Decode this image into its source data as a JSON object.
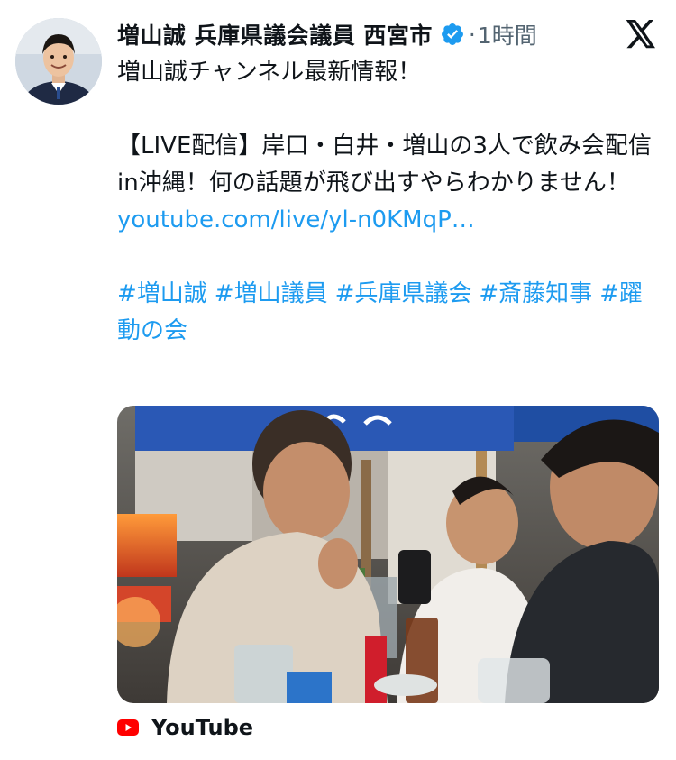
{
  "author": {
    "display_name": "増山誠 兵庫県議会議員 西宮市",
    "separator": "·",
    "timestamp": "1時間",
    "verified": true
  },
  "tweet": {
    "line1": "増山誠チャンネル最新情報！",
    "para2": "【LIVE配信】岸口・白井・増山の3人で飲み会配信in沖縄！何の話題が飛び出すやらわかりません！",
    "link": "youtube.com/live/yl-n0KMqP…",
    "hashtags": [
      "#増山誠",
      "#増山議員",
      "#兵庫県議会",
      "#斎藤知事",
      "#躍動の会"
    ]
  },
  "card": {
    "source_label": "YouTube"
  },
  "colors": {
    "link": "#1d9bf0",
    "verified": "#1d9bf0",
    "text": "#0f1419",
    "secondary": "#536471",
    "youtube_red": "#ff0000"
  },
  "icons": [
    "verified-badge-icon",
    "x-logo-icon",
    "youtube-icon"
  ]
}
